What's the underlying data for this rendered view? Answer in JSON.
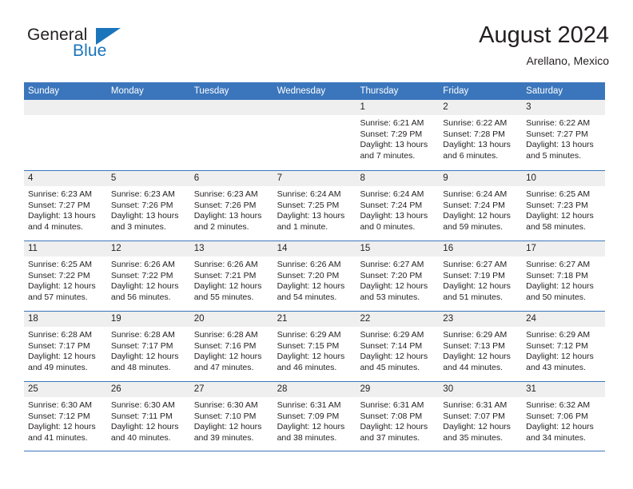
{
  "brand": {
    "name_part1": "General",
    "name_part2": "Blue",
    "accent_color": "#1b75bb",
    "triangle_icon": "brand-triangle-icon"
  },
  "header": {
    "title": "August 2024",
    "subtitle": "Arellano, Mexico"
  },
  "theme": {
    "header_blue": "#3b76bc",
    "daynum_band": "#efefef",
    "text": "#231f20"
  },
  "calendar": {
    "weekdays": [
      "Sunday",
      "Monday",
      "Tuesday",
      "Wednesday",
      "Thursday",
      "Friday",
      "Saturday"
    ],
    "weeks": [
      [
        {
          "day": "",
          "empty": true
        },
        {
          "day": "",
          "empty": true
        },
        {
          "day": "",
          "empty": true
        },
        {
          "day": "",
          "empty": true
        },
        {
          "day": "1",
          "sunrise": "Sunrise: 6:21 AM",
          "sunset": "Sunset: 7:29 PM",
          "daylight": "Daylight: 13 hours and 7 minutes."
        },
        {
          "day": "2",
          "sunrise": "Sunrise: 6:22 AM",
          "sunset": "Sunset: 7:28 PM",
          "daylight": "Daylight: 13 hours and 6 minutes."
        },
        {
          "day": "3",
          "sunrise": "Sunrise: 6:22 AM",
          "sunset": "Sunset: 7:27 PM",
          "daylight": "Daylight: 13 hours and 5 minutes."
        }
      ],
      [
        {
          "day": "4",
          "sunrise": "Sunrise: 6:23 AM",
          "sunset": "Sunset: 7:27 PM",
          "daylight": "Daylight: 13 hours and 4 minutes."
        },
        {
          "day": "5",
          "sunrise": "Sunrise: 6:23 AM",
          "sunset": "Sunset: 7:26 PM",
          "daylight": "Daylight: 13 hours and 3 minutes."
        },
        {
          "day": "6",
          "sunrise": "Sunrise: 6:23 AM",
          "sunset": "Sunset: 7:26 PM",
          "daylight": "Daylight: 13 hours and 2 minutes."
        },
        {
          "day": "7",
          "sunrise": "Sunrise: 6:24 AM",
          "sunset": "Sunset: 7:25 PM",
          "daylight": "Daylight: 13 hours and 1 minute."
        },
        {
          "day": "8",
          "sunrise": "Sunrise: 6:24 AM",
          "sunset": "Sunset: 7:24 PM",
          "daylight": "Daylight: 13 hours and 0 minutes."
        },
        {
          "day": "9",
          "sunrise": "Sunrise: 6:24 AM",
          "sunset": "Sunset: 7:24 PM",
          "daylight": "Daylight: 12 hours and 59 minutes."
        },
        {
          "day": "10",
          "sunrise": "Sunrise: 6:25 AM",
          "sunset": "Sunset: 7:23 PM",
          "daylight": "Daylight: 12 hours and 58 minutes."
        }
      ],
      [
        {
          "day": "11",
          "sunrise": "Sunrise: 6:25 AM",
          "sunset": "Sunset: 7:22 PM",
          "daylight": "Daylight: 12 hours and 57 minutes."
        },
        {
          "day": "12",
          "sunrise": "Sunrise: 6:26 AM",
          "sunset": "Sunset: 7:22 PM",
          "daylight": "Daylight: 12 hours and 56 minutes."
        },
        {
          "day": "13",
          "sunrise": "Sunrise: 6:26 AM",
          "sunset": "Sunset: 7:21 PM",
          "daylight": "Daylight: 12 hours and 55 minutes."
        },
        {
          "day": "14",
          "sunrise": "Sunrise: 6:26 AM",
          "sunset": "Sunset: 7:20 PM",
          "daylight": "Daylight: 12 hours and 54 minutes."
        },
        {
          "day": "15",
          "sunrise": "Sunrise: 6:27 AM",
          "sunset": "Sunset: 7:20 PM",
          "daylight": "Daylight: 12 hours and 53 minutes."
        },
        {
          "day": "16",
          "sunrise": "Sunrise: 6:27 AM",
          "sunset": "Sunset: 7:19 PM",
          "daylight": "Daylight: 12 hours and 51 minutes."
        },
        {
          "day": "17",
          "sunrise": "Sunrise: 6:27 AM",
          "sunset": "Sunset: 7:18 PM",
          "daylight": "Daylight: 12 hours and 50 minutes."
        }
      ],
      [
        {
          "day": "18",
          "sunrise": "Sunrise: 6:28 AM",
          "sunset": "Sunset: 7:17 PM",
          "daylight": "Daylight: 12 hours and 49 minutes."
        },
        {
          "day": "19",
          "sunrise": "Sunrise: 6:28 AM",
          "sunset": "Sunset: 7:17 PM",
          "daylight": "Daylight: 12 hours and 48 minutes."
        },
        {
          "day": "20",
          "sunrise": "Sunrise: 6:28 AM",
          "sunset": "Sunset: 7:16 PM",
          "daylight": "Daylight: 12 hours and 47 minutes."
        },
        {
          "day": "21",
          "sunrise": "Sunrise: 6:29 AM",
          "sunset": "Sunset: 7:15 PM",
          "daylight": "Daylight: 12 hours and 46 minutes."
        },
        {
          "day": "22",
          "sunrise": "Sunrise: 6:29 AM",
          "sunset": "Sunset: 7:14 PM",
          "daylight": "Daylight: 12 hours and 45 minutes."
        },
        {
          "day": "23",
          "sunrise": "Sunrise: 6:29 AM",
          "sunset": "Sunset: 7:13 PM",
          "daylight": "Daylight: 12 hours and 44 minutes."
        },
        {
          "day": "24",
          "sunrise": "Sunrise: 6:29 AM",
          "sunset": "Sunset: 7:12 PM",
          "daylight": "Daylight: 12 hours and 43 minutes."
        }
      ],
      [
        {
          "day": "25",
          "sunrise": "Sunrise: 6:30 AM",
          "sunset": "Sunset: 7:12 PM",
          "daylight": "Daylight: 12 hours and 41 minutes."
        },
        {
          "day": "26",
          "sunrise": "Sunrise: 6:30 AM",
          "sunset": "Sunset: 7:11 PM",
          "daylight": "Daylight: 12 hours and 40 minutes."
        },
        {
          "day": "27",
          "sunrise": "Sunrise: 6:30 AM",
          "sunset": "Sunset: 7:10 PM",
          "daylight": "Daylight: 12 hours and 39 minutes."
        },
        {
          "day": "28",
          "sunrise": "Sunrise: 6:31 AM",
          "sunset": "Sunset: 7:09 PM",
          "daylight": "Daylight: 12 hours and 38 minutes."
        },
        {
          "day": "29",
          "sunrise": "Sunrise: 6:31 AM",
          "sunset": "Sunset: 7:08 PM",
          "daylight": "Daylight: 12 hours and 37 minutes."
        },
        {
          "day": "30",
          "sunrise": "Sunrise: 6:31 AM",
          "sunset": "Sunset: 7:07 PM",
          "daylight": "Daylight: 12 hours and 35 minutes."
        },
        {
          "day": "31",
          "sunrise": "Sunrise: 6:32 AM",
          "sunset": "Sunset: 7:06 PM",
          "daylight": "Daylight: 12 hours and 34 minutes."
        }
      ]
    ]
  }
}
